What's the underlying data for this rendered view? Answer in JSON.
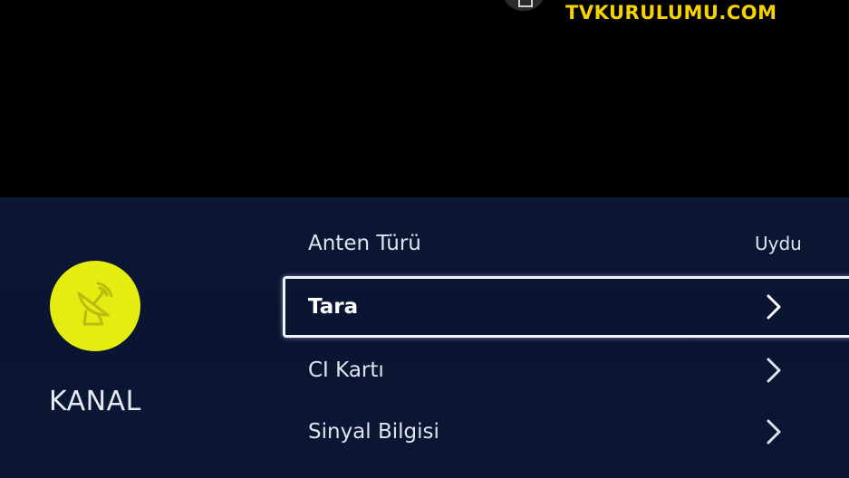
{
  "watermark": "TVKURULUMU.COM",
  "category": {
    "label": "KANAL",
    "icon": "satellite-dish-icon",
    "accent_color": "#e5ec12"
  },
  "menu": {
    "items": [
      {
        "label": "Anten Türü",
        "value": "Uydu",
        "selected": false
      },
      {
        "label": "Tara",
        "selected": true,
        "icon": "chevron-right-icon"
      },
      {
        "label": "CI Kartı",
        "selected": false,
        "icon": "chevron-right-icon"
      },
      {
        "label": "Sinyal Bilgisi",
        "selected": false,
        "icon": "chevron-right-icon"
      }
    ]
  },
  "colors": {
    "panel": "#0b1634",
    "watermark": "#f5d300",
    "text": "#dfe3ef",
    "selection_border": "#f2f4ff"
  }
}
